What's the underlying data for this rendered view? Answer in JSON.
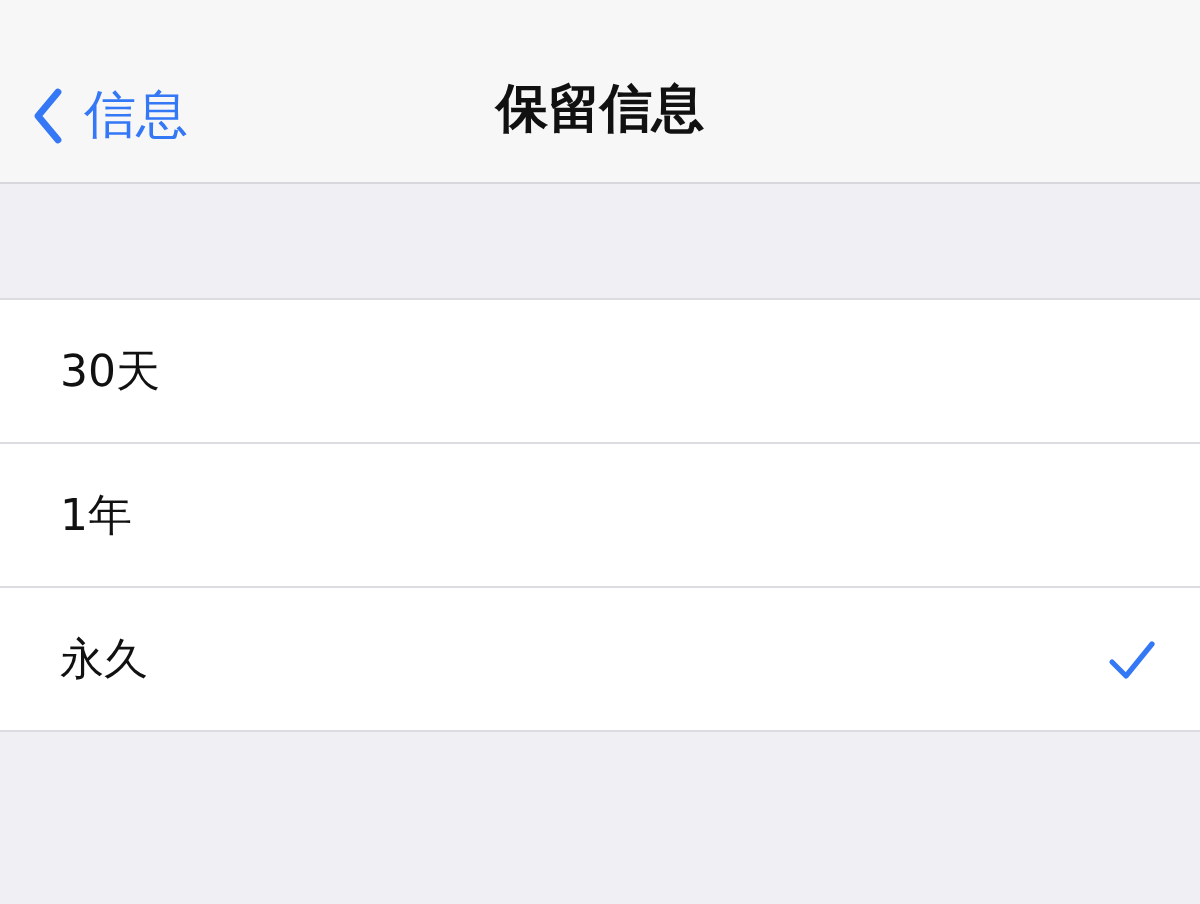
{
  "nav": {
    "back_label": "信息",
    "title": "保留信息"
  },
  "options": [
    {
      "label": "30天",
      "selected": false
    },
    {
      "label": "1年",
      "selected": false
    },
    {
      "label": "永久",
      "selected": true
    }
  ]
}
